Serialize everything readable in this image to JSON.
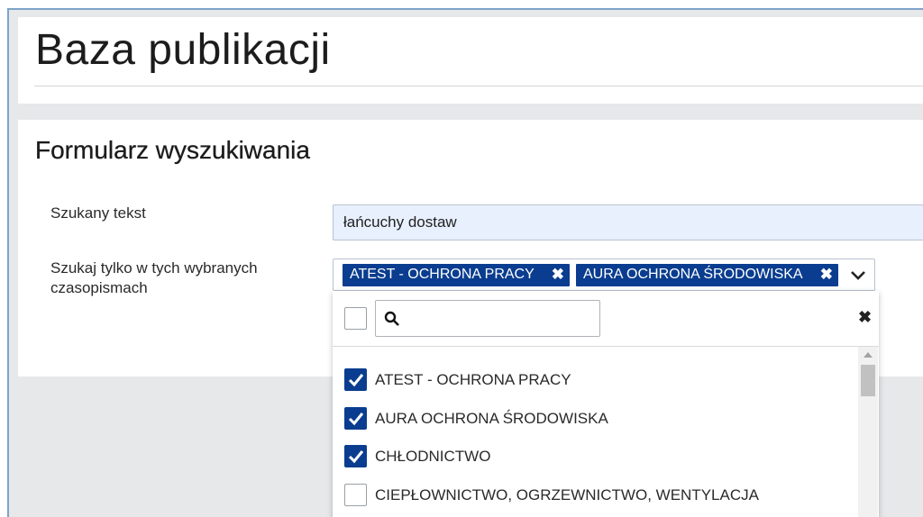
{
  "page_title": "Baza publikacji",
  "form": {
    "title": "Formularz wyszukiwania",
    "search_text_label": "Szukany tekst",
    "search_text_value": "łańcuchy dostaw",
    "journals_label": "Szukaj tylko w tych wybranych czasopismach",
    "selected_chips": [
      {
        "label": "ATEST - OCHRONA PRACY",
        "remove_icon": "✖"
      },
      {
        "label": "AURA OCHRONA ŚRODOWISKA",
        "remove_icon": "✖"
      }
    ],
    "dropdown_icon": "chevron-down-icon"
  },
  "dropdown": {
    "search_value": "",
    "clear_icon": "✖",
    "options": [
      {
        "label": "ATEST - OCHRONA PRACY",
        "checked": true
      },
      {
        "label": "AURA OCHRONA ŚRODOWISKA",
        "checked": true
      },
      {
        "label": "CHŁODNICTWO",
        "checked": true
      },
      {
        "label": "CIEPŁOWNICTWO, OGRZEWNICTWO, WENTYLACJA",
        "checked": false
      }
    ]
  },
  "colors": {
    "accent": "#0a3d8f",
    "input_bg": "#e8f0fe",
    "page_bg": "#e7e8ea"
  }
}
